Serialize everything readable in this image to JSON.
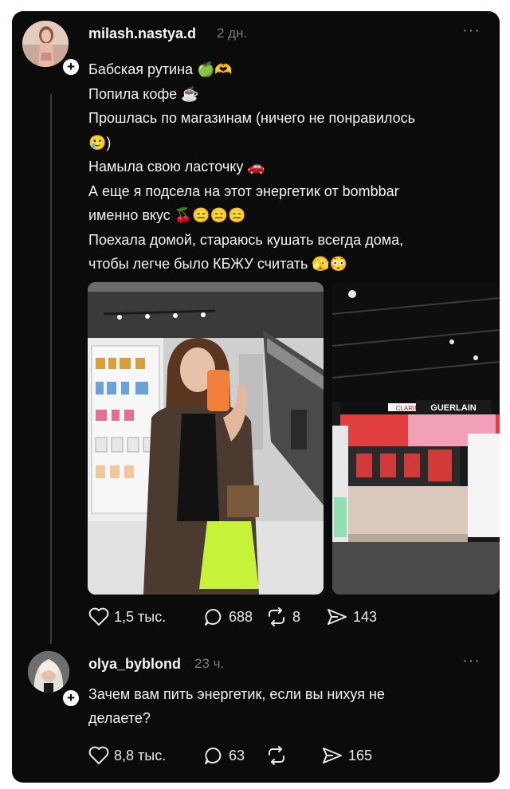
{
  "post": {
    "username": "milash.nastya.d",
    "time": "2 дн.",
    "more": "···",
    "lines": [
      "Бабская рутина 🍏🫶",
      "Попила кофе ☕",
      "Прошлась по магазинам (ничего не понравилось",
      "🥲)",
      "Намыла свою ласточку 🚗",
      "А еще я подсела на этот энергетик от bombbar",
      "именно вкус 🍒😑😑😑",
      "Поехала домой, стараюсь кушать всегда дома,",
      "чтобы легче было КБЖУ считать 🫣😳"
    ],
    "store_signs": {
      "left_sign": "",
      "clarins": "CLARINS",
      "guerlain": "GUERLAIN"
    },
    "likes": "1,5 тыс.",
    "comments": "688",
    "reposts": "8",
    "shares": "143"
  },
  "reply": {
    "username": "olya_byblond",
    "time": "23 ч.",
    "more": "···",
    "lines": [
      "Зачем вам пить энергетик, если вы нихуя не",
      "делаете?"
    ],
    "likes": "8,8 тыс.",
    "comments": "63",
    "reposts": "",
    "shares": "165"
  },
  "colors": {
    "background": "#0b0b0b",
    "text": "#f2f2f2",
    "muted": "#7a7a7a",
    "bag": "#c6f23a"
  }
}
